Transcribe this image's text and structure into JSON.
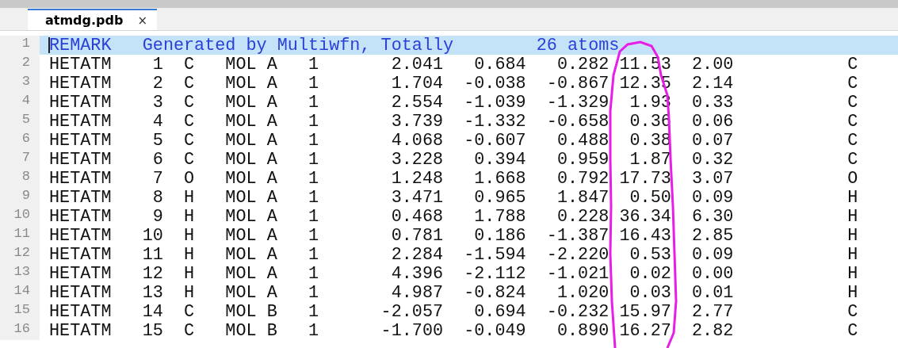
{
  "tabs": [
    {
      "label": "atmdg.pdb",
      "close": "×",
      "selected": true
    }
  ],
  "editor": {
    "lines": [
      {
        "number": "1",
        "kind": "remark",
        "selected": true,
        "text": "REMARK   Generated by Multiwfn, Totally        26 atoms"
      },
      {
        "number": "2",
        "kind": "atom",
        "selected": false,
        "text": "HETATM    1  C   MOL A   1       2.041   0.684   0.282 11.53  2.00           C"
      },
      {
        "number": "3",
        "kind": "atom",
        "selected": false,
        "text": "HETATM    2  C   MOL A   1       1.704  -0.038  -0.867 12.35  2.14           C"
      },
      {
        "number": "4",
        "kind": "atom",
        "selected": false,
        "text": "HETATM    3  C   MOL A   1       2.554  -1.039  -1.329  1.93  0.33           C"
      },
      {
        "number": "5",
        "kind": "atom",
        "selected": false,
        "text": "HETATM    4  C   MOL A   1       3.739  -1.332  -0.658  0.36  0.06           C"
      },
      {
        "number": "6",
        "kind": "atom",
        "selected": false,
        "text": "HETATM    5  C   MOL A   1       4.068  -0.607   0.488  0.38  0.07           C"
      },
      {
        "number": "7",
        "kind": "atom",
        "selected": false,
        "text": "HETATM    6  C   MOL A   1       3.228   0.394   0.959  1.87  0.32           C"
      },
      {
        "number": "8",
        "kind": "atom",
        "selected": false,
        "text": "HETATM    7  O   MOL A   1       1.248   1.668   0.792 17.73  3.07           O"
      },
      {
        "number": "9",
        "kind": "atom",
        "selected": false,
        "text": "HETATM    8  H   MOL A   1       3.471   0.965   1.847  0.50  0.09           H"
      },
      {
        "number": "10",
        "kind": "atom",
        "selected": false,
        "text": "HETATM    9  H   MOL A   1       0.468   1.788   0.228 36.34  6.30           H"
      },
      {
        "number": "11",
        "kind": "atom",
        "selected": false,
        "text": "HETATM   10  H   MOL A   1       0.781   0.186  -1.387 16.43  2.85           H"
      },
      {
        "number": "12",
        "kind": "atom",
        "selected": false,
        "text": "HETATM   11  H   MOL A   1       2.284  -1.594  -2.220  0.53  0.09           H"
      },
      {
        "number": "13",
        "kind": "atom",
        "selected": false,
        "text": "HETATM   12  H   MOL A   1       4.396  -2.112  -1.021  0.02  0.00           H"
      },
      {
        "number": "14",
        "kind": "atom",
        "selected": false,
        "text": "HETATM   13  H   MOL A   1       4.987  -0.824   1.020  0.03  0.01           H"
      },
      {
        "number": "15",
        "kind": "atom",
        "selected": false,
        "text": "HETATM   14  C   MOL B   1      -2.057   0.694  -0.232 15.97  2.77           C"
      },
      {
        "number": "16",
        "kind": "atom",
        "selected": false,
        "text": "HETATM   15  C   MOL B   1      -1.700  -0.049   0.890 16.27  2.82           C"
      }
    ]
  }
}
